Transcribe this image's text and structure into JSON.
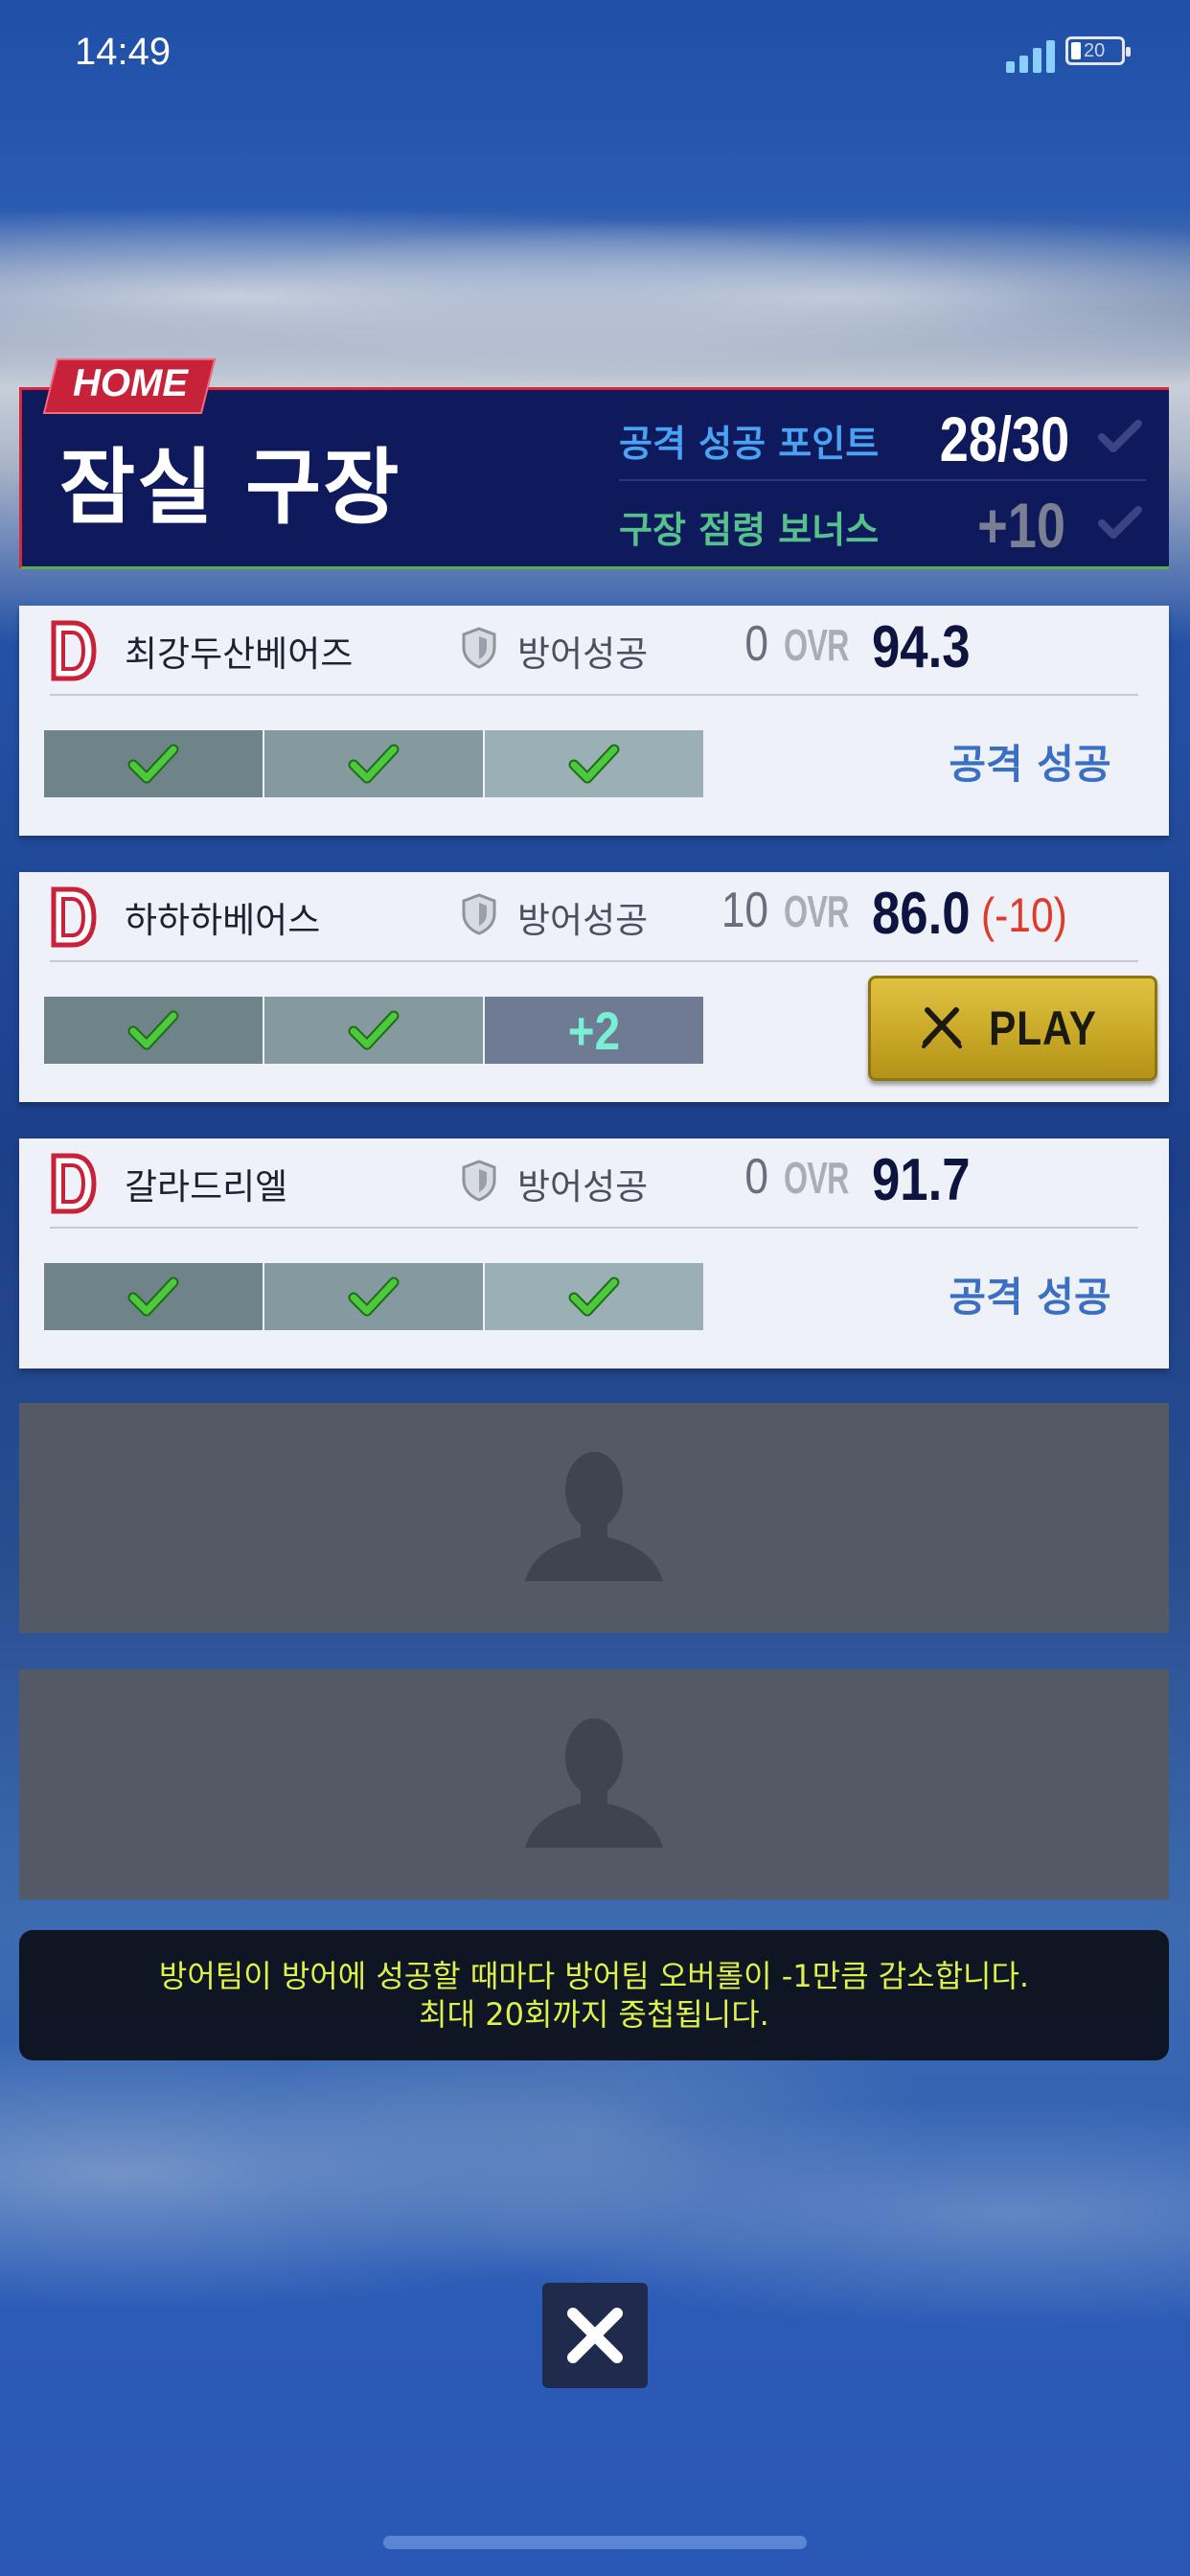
{
  "status_bar": {
    "time": "14:49",
    "battery": "20"
  },
  "header": {
    "home_tag": "HOME",
    "stadium_name": "잠실 구장",
    "stats": [
      {
        "label": "공격 성공 포인트",
        "value": "28/30"
      },
      {
        "label": "구장 점령 보너스",
        "value": "+10"
      }
    ]
  },
  "defense_label": "방어성공",
  "ovr_label": "OVR",
  "teams": [
    {
      "name": "최강두산베어즈",
      "defense_wins": "0",
      "ovr": "94.3",
      "ovr_delta": "",
      "slots": [
        "check",
        "check",
        "check"
      ],
      "status": "공격 성공"
    },
    {
      "name": "하하하베어스",
      "defense_wins": "10",
      "ovr": "86.0",
      "ovr_delta": "(-10)",
      "slots": [
        "check",
        "check",
        "+2"
      ],
      "status": "",
      "play_label": "PLAY"
    },
    {
      "name": "갈라드리엘",
      "defense_wins": "0",
      "ovr": "91.7",
      "ovr_delta": "",
      "slots": [
        "check",
        "check",
        "check"
      ],
      "status": "공격 성공"
    }
  ],
  "info": {
    "line1": "방어팀이 방어에 성공할 때마다 방어팀 오버롤이 -1만큼 감소합니다.",
    "line2": "최대 20회까지 중첩됩니다."
  },
  "icons": {
    "team_logo": "doosan-d-logo-icon",
    "defense": "shield-icon",
    "slot": "check-icon",
    "play": "crossed-bats-icon",
    "empty": "person-silhouette-icon",
    "close": "close-icon"
  },
  "colors": {
    "header_bg": "#0f1a5c",
    "home_tag": "#c8213a",
    "stat_label_1": "#4aa2f2",
    "stat_label_2": "#56c18b",
    "play_button": "#c9a926",
    "ovr_delta": "#e03a2c",
    "result_text": "#3a6fc3",
    "info_text": "#dff04a"
  }
}
